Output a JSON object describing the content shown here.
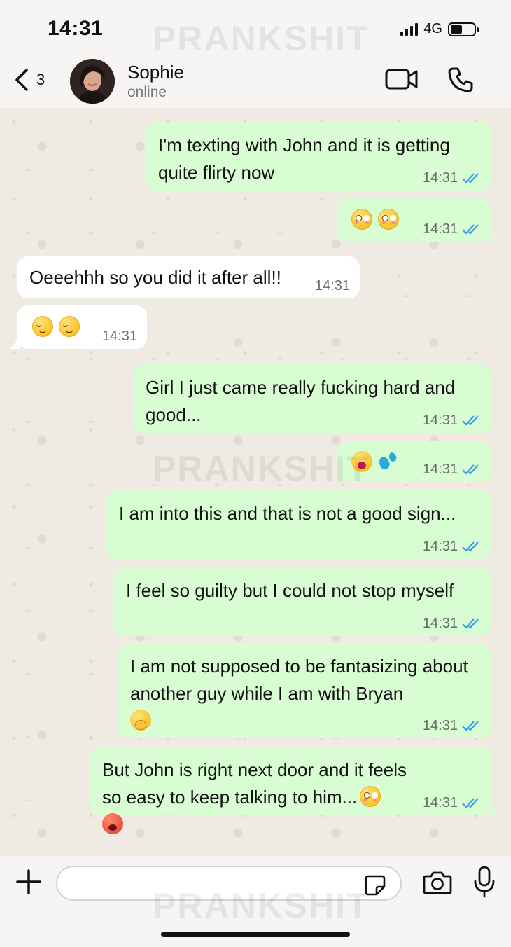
{
  "status_bar": {
    "time": "14:31",
    "network": "4G"
  },
  "watermark": "PRANKSHIT",
  "header": {
    "back_count": "3",
    "contact_name": "Sophie",
    "contact_status": "online"
  },
  "colors": {
    "outgoing_bubble": "#d9fdd3",
    "incoming_bubble": "#ffffff",
    "chat_background": "#efeae2",
    "read_tick": "#3b9ee8"
  },
  "messages": [
    {
      "direction": "out",
      "text": "I'm texting with John and it is getting quite flirty now",
      "time": "14:31",
      "status": "read"
    },
    {
      "direction": "out",
      "emojis": [
        "flushed-face",
        "flushed-face"
      ],
      "time": "14:31",
      "status": "read"
    },
    {
      "direction": "in",
      "text": "Oeeehhh so you did it after all!!",
      "time": "14:31"
    },
    {
      "direction": "in",
      "emojis": [
        "relieved-face",
        "relieved-face"
      ],
      "time": "14:31"
    },
    {
      "direction": "out",
      "text": "Girl I just came really fucking hard and good...",
      "time": "14:31",
      "status": "read"
    },
    {
      "direction": "out",
      "emojis": [
        "weary-face",
        "sweat-droplets"
      ],
      "time": "14:31",
      "status": "read"
    },
    {
      "direction": "out",
      "text": "I am into this and that is not a good sign...",
      "time": "14:31",
      "status": "read"
    },
    {
      "direction": "out",
      "text": "I feel so guilty but I could not stop myself",
      "time": "14:31",
      "status": "read"
    },
    {
      "direction": "out",
      "text": "I am not supposed to be fantasizing about another guy while I am with Bryan",
      "trailing_emoji": "face-with-hand-over-mouth",
      "time": "14:31",
      "status": "read"
    },
    {
      "direction": "out",
      "text": "But John is right next door and it feels so easy to keep talking to him...",
      "trailing_emojis": [
        "flushed-face",
        "hot-face"
      ],
      "time": "14:31",
      "status": "read"
    }
  ],
  "composer": {
    "placeholder": ""
  }
}
